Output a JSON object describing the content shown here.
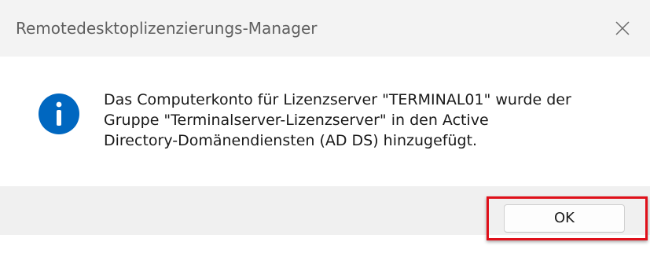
{
  "window": {
    "title": "Remotedesktoplizenzierungs-Manager",
    "close_icon": "close-icon"
  },
  "dialog": {
    "icon": "info-icon",
    "icon_color": "#0067c0",
    "message_lines": [
      "Das Computerkonto für Lizenzserver \"TERMINAL01\" wurde der",
      "Gruppe \"Terminalserver-Lizenzserver\" in den Active",
      "Directory-Domänendiensten (AD DS) hinzugefügt."
    ]
  },
  "footer": {
    "ok_label": "OK"
  },
  "annotation": {
    "highlight_color": "#e0101a"
  }
}
